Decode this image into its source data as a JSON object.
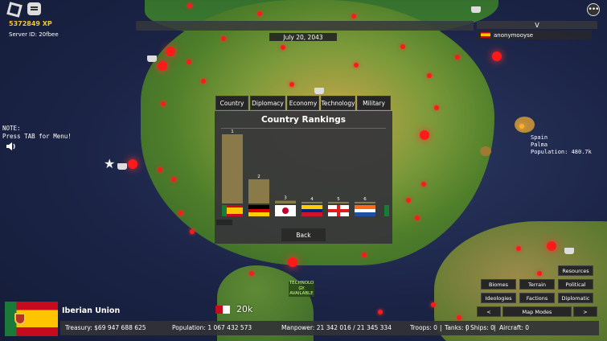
{
  "hud": {
    "xp": "5372849 XP",
    "server_id": "Server ID: 20fbee",
    "note_line1": "NOTE:",
    "note_line2": "Press TAB for Menu!",
    "menu_glyph": "•••"
  },
  "top": {
    "date": "July 20, 2043",
    "collapse_glyph": "V",
    "player_name": "anonymooyse"
  },
  "map": {
    "city_country": "Spain",
    "city_name": "Palma",
    "city_population": "Population: 480.7k",
    "tech_line1": "TECHNOLO",
    "tech_line2": "GY",
    "tech_line3": "AVAILABLE",
    "unit_count": "20k"
  },
  "tabs": {
    "country": "Country",
    "diplomacy": "Diplomacy",
    "economy": "Economy",
    "technology": "Technology",
    "military": "Military"
  },
  "rankings": {
    "title": "Country Rankings",
    "back_label": "Back"
  },
  "chart_data": {
    "type": "bar",
    "title": "Country Rankings",
    "categories": [
      "1",
      "2",
      "3",
      "4",
      "5",
      "6"
    ],
    "values": [
      100,
      35,
      4,
      2,
      1,
      1
    ],
    "flags": [
      "iberian-union",
      "germany",
      "japan",
      "venezuela",
      "georgia",
      "netherlands-like"
    ],
    "bar_color": "#8a7a4a"
  },
  "country": {
    "name": "Iberian Union",
    "treasury": "Treasury:  $69 947 688 625",
    "population": "Population: 1 067 432 573",
    "manpower": "Manpower:  21 342 016  /  21 345 334",
    "troops": "Troops: 0",
    "tanks": "Tanks: 0",
    "ships": "Ships: 0",
    "aircraft": "Aircraft: 0",
    "sep": "|"
  },
  "map_buttons": {
    "resources": "Resources",
    "biomes": "Biomes",
    "terrain": "Terrain",
    "political": "Political",
    "ideologies": "Ideologies",
    "factions": "Factions",
    "diplomatic": "Diplomatic",
    "prev": "<",
    "map_modes": "Map Modes",
    "next": ">"
  }
}
